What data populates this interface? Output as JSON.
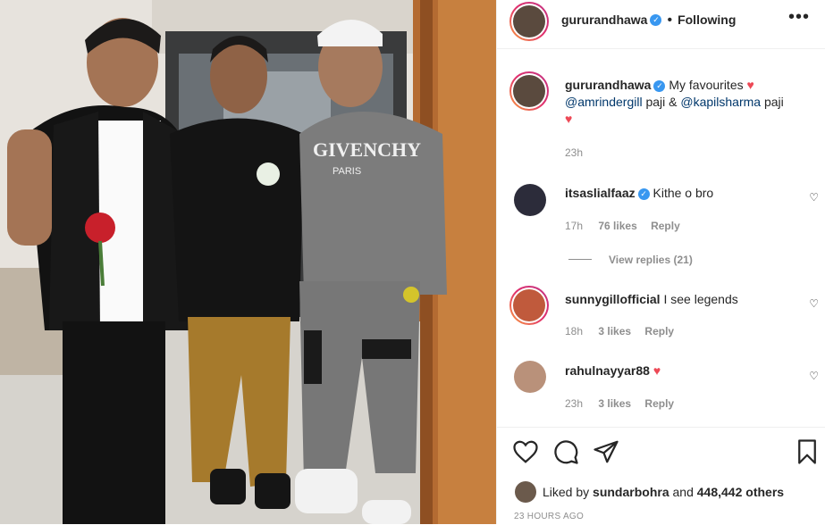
{
  "post": {
    "username": "gururandhawa",
    "follow_status": "Following",
    "more_icon": "more-horizontal-icon",
    "caption_parts": {
      "text1": "My favourites",
      "mention1": "@amrindergill",
      "text2": "paji &",
      "mention2": "@kapilsharma",
      "text3": "paji"
    },
    "caption_time": "23h"
  },
  "comments": [
    {
      "username": "itsaslialfaaz",
      "verified": true,
      "text": "Kithe o bro",
      "time": "17h",
      "likes": "76 likes",
      "reply": "Reply",
      "view_replies": "View replies (21)"
    },
    {
      "username": "sunnygillofficial",
      "verified": false,
      "text": "I see legends",
      "time": "18h",
      "likes": "3 likes",
      "reply": "Reply"
    },
    {
      "username": "rahulnayyar88",
      "verified": false,
      "text": "",
      "time": "23h",
      "likes": "3 likes",
      "reply": "Reply"
    }
  ],
  "footer": {
    "liked_by_prefix": "Liked by",
    "liked_by_user": "sundarbohra",
    "liked_by_and": "and",
    "others_count": "448,442 others",
    "timestamp": "23 HOURS AGO"
  },
  "colors": {
    "verified": "#3897f0",
    "heart": "#ed4956",
    "mention": "#00376b",
    "muted": "#8e8e8e"
  }
}
